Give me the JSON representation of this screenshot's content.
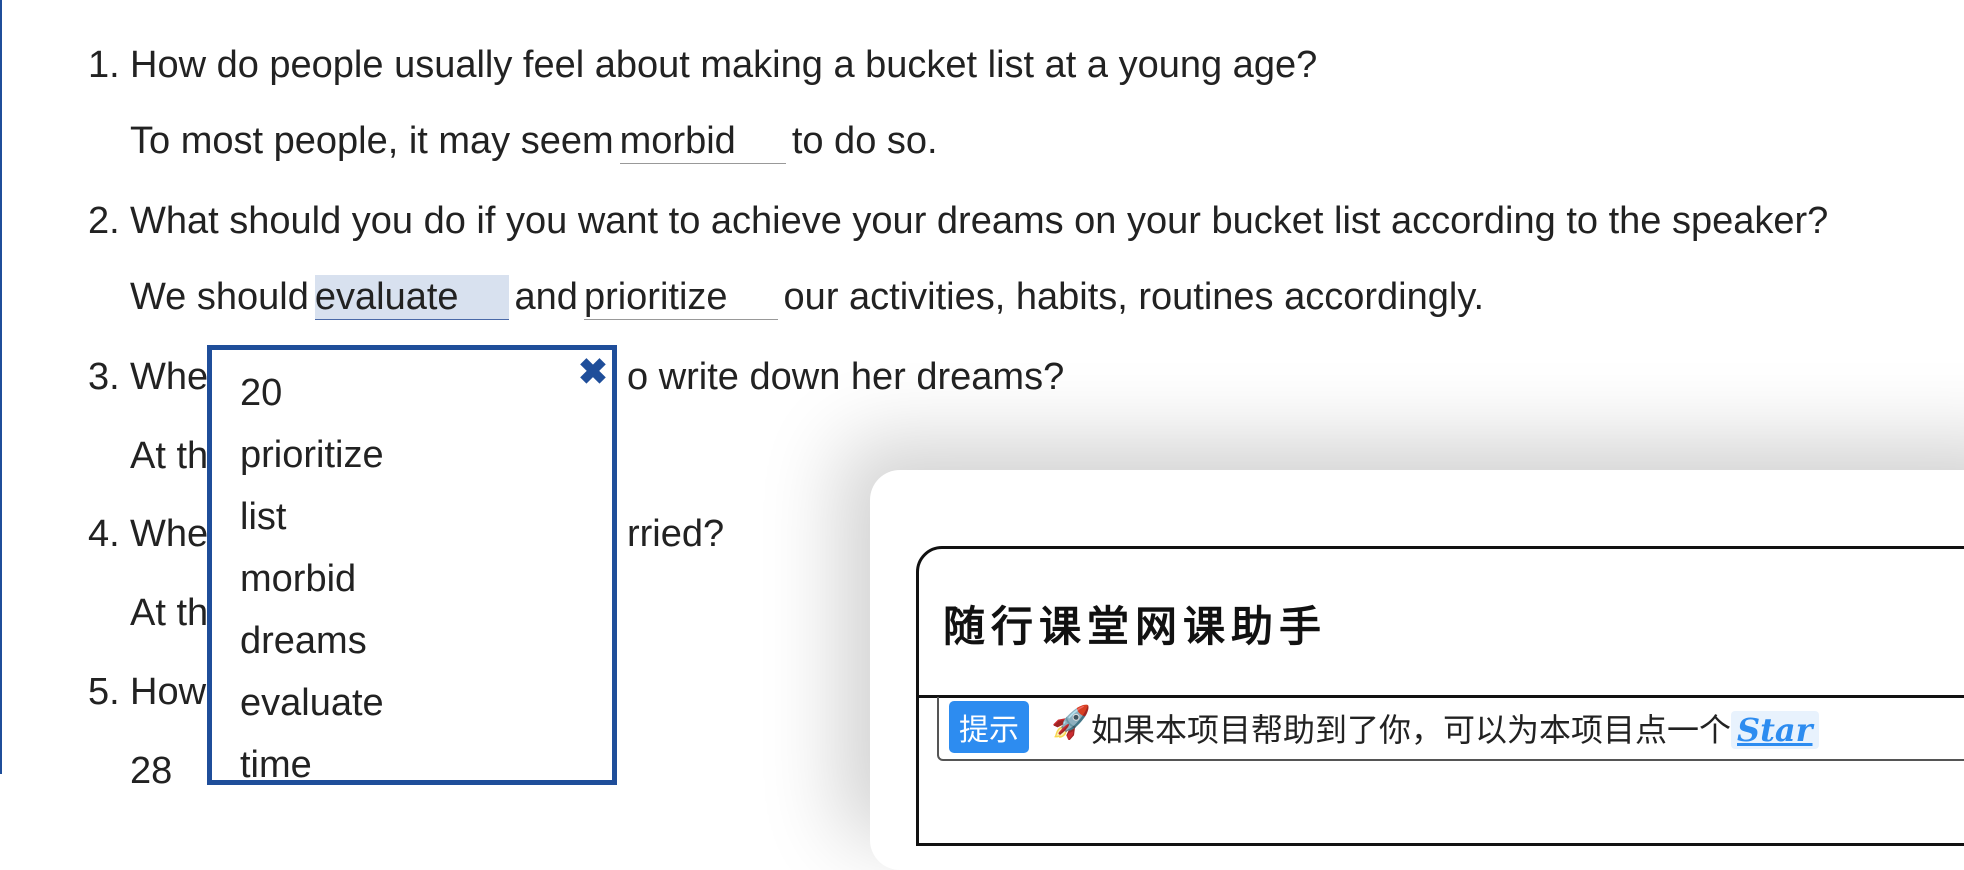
{
  "questions": [
    {
      "num": "1.",
      "text": "How do people usually feel about making a bucket list at a young age?",
      "answer": {
        "before": "To most people, it may seem",
        "blank1": "morbid",
        "after": "to do so."
      }
    },
    {
      "num": "2.",
      "text": "What should you do if you want to achieve your dreams on your bucket list according to the speaker?",
      "answer": {
        "before": "We should",
        "blank1": "evaluate",
        "middle": "and",
        "blank2": "prioritize",
        "after": "our activities, habits, routines accordingly."
      }
    },
    {
      "num": "3.",
      "text_start": "Whe",
      "text_end": "o write down her dreams?",
      "answer_start": "At th"
    },
    {
      "num": "4.",
      "text_start": "Whe",
      "text_end": "rried?",
      "answer_start": "At th"
    },
    {
      "num": "5.",
      "text_start": "How",
      "answer_start": "28"
    }
  ],
  "popup": {
    "close_icon": "close-icon",
    "options": [
      "20",
      "prioritize",
      "list",
      "morbid",
      "dreams",
      "evaluate",
      "time"
    ]
  },
  "helper": {
    "title": "随行课堂网课助手",
    "tip_badge": "提示",
    "tip_icon": "🚀",
    "tip_text": "如果本项目帮助到了你，可以为本项目点一个",
    "star_link": "Star"
  }
}
